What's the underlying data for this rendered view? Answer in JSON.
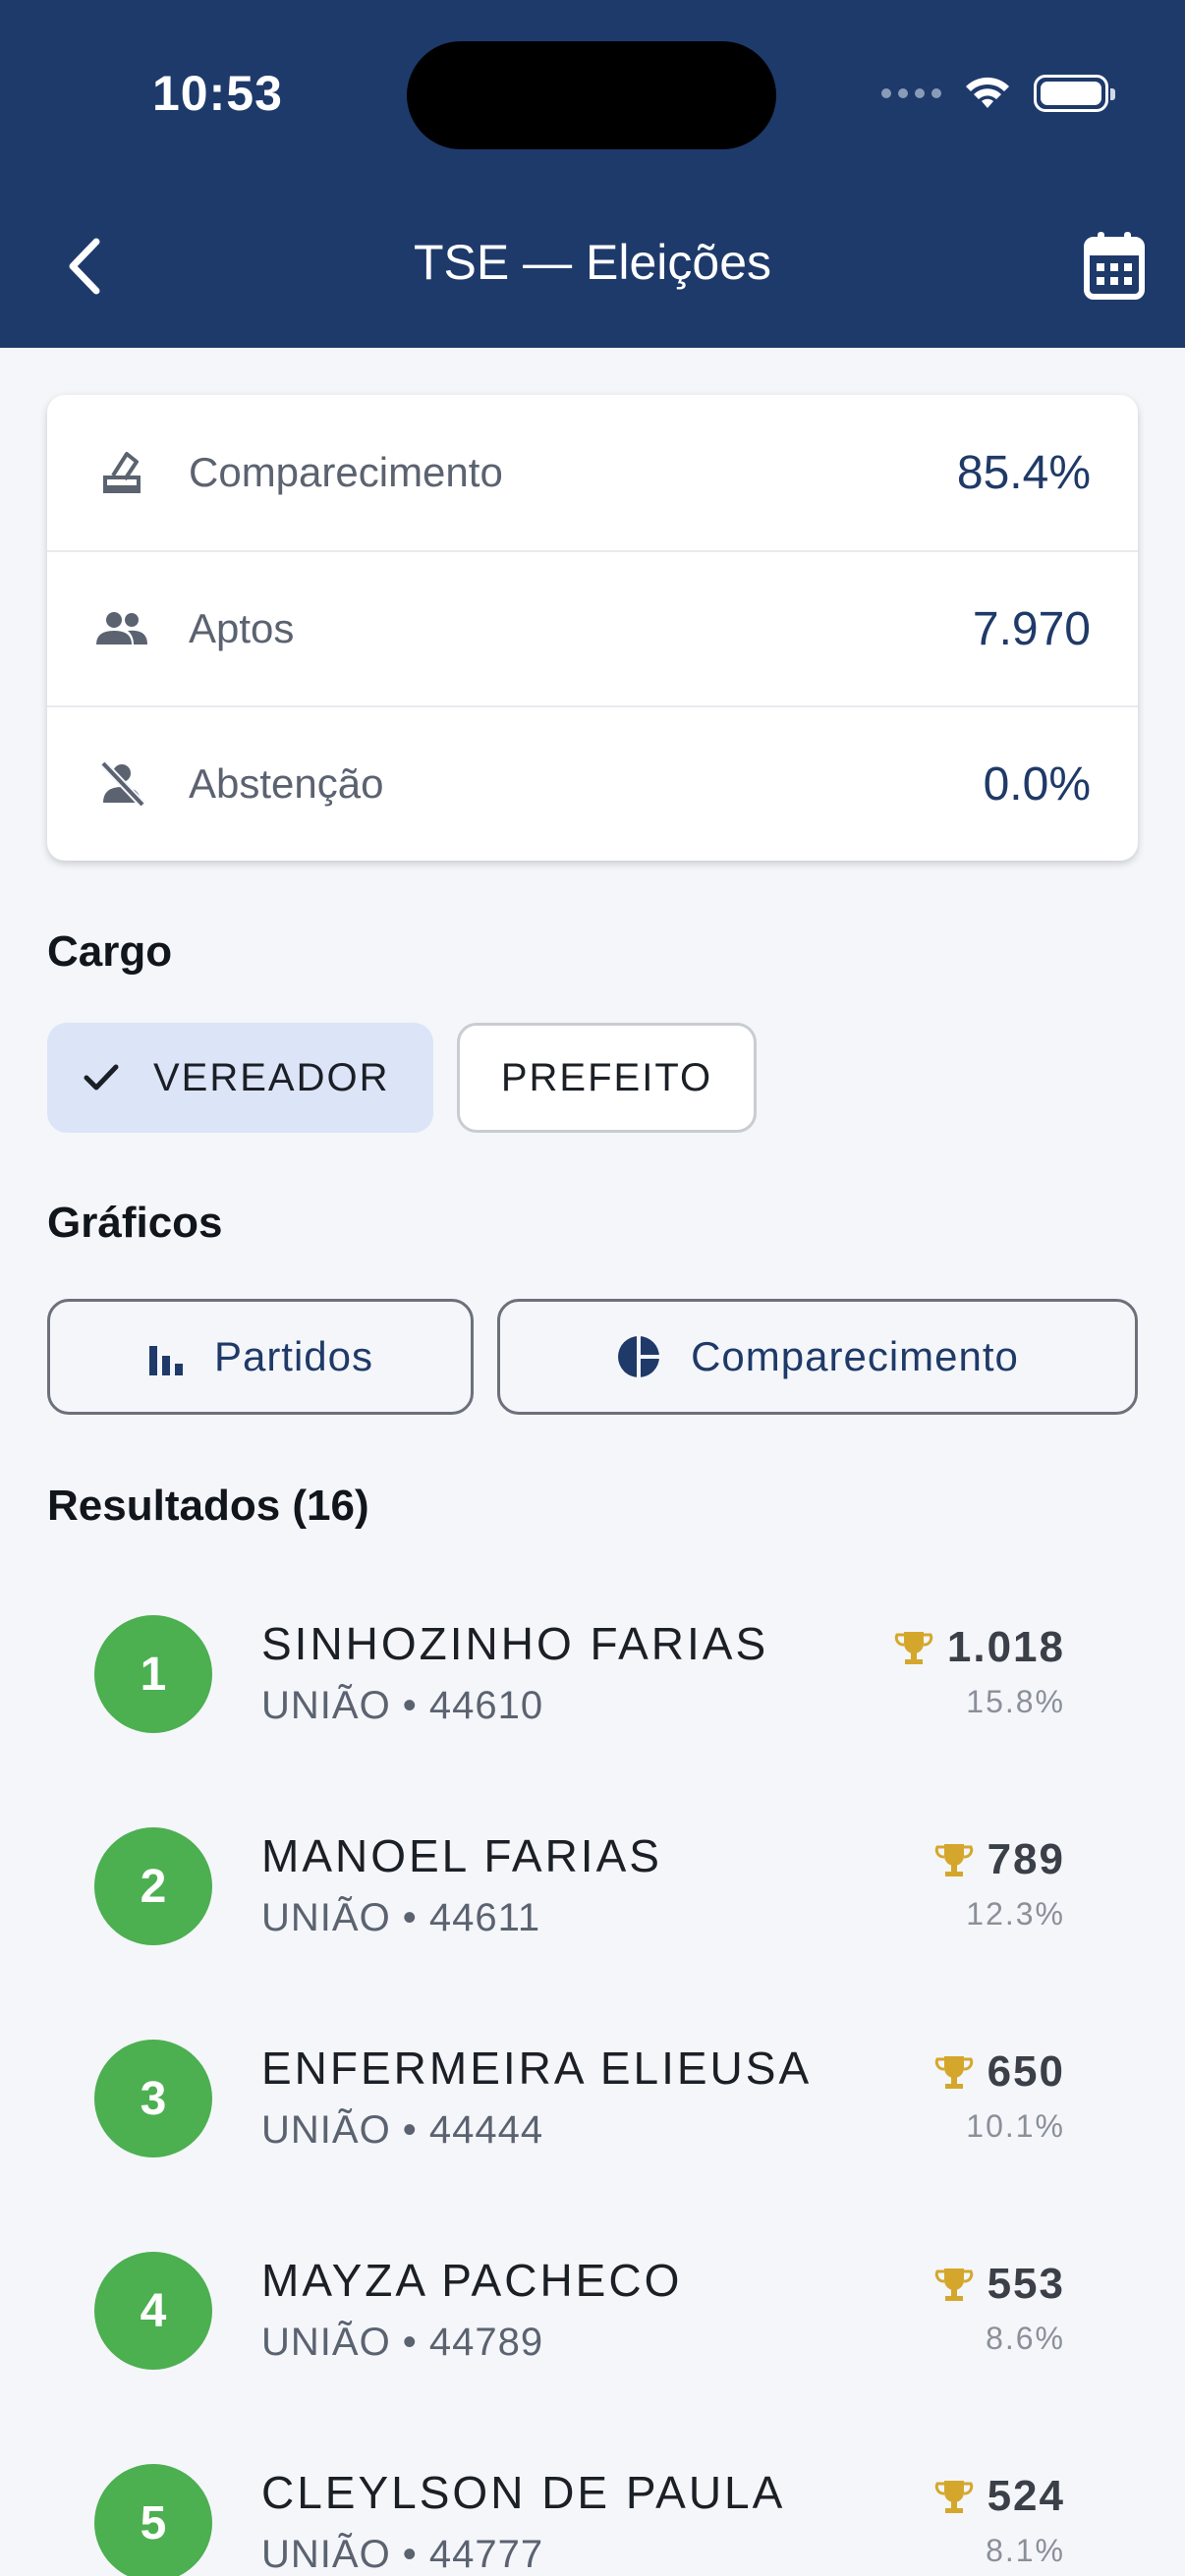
{
  "status_bar": {
    "time": "10:53"
  },
  "header": {
    "title": "TSE — Eleições"
  },
  "stats": [
    {
      "label": "Comparecimento",
      "value": "85.4%",
      "icon": "ballot-icon"
    },
    {
      "label": "Aptos",
      "value": "7.970",
      "icon": "people-icon"
    },
    {
      "label": "Abstenção",
      "value": "0.0%",
      "icon": "person-off-icon"
    }
  ],
  "cargo": {
    "title": "Cargo",
    "options": [
      {
        "label": "VEREADOR",
        "selected": true
      },
      {
        "label": "PREFEITO",
        "selected": false
      }
    ]
  },
  "graficos": {
    "title": "Gráficos",
    "buttons": [
      {
        "label": "Partidos",
        "icon": "bar-chart-icon"
      },
      {
        "label": "Comparecimento",
        "icon": "pie-chart-icon"
      }
    ]
  },
  "resultados": {
    "title": "Resultados (16)",
    "items": [
      {
        "rank": "1",
        "name": "SINHOZINHO FARIAS",
        "party": "UNIÃO • 44610",
        "votes": "1.018",
        "pct": "15.8%"
      },
      {
        "rank": "2",
        "name": "MANOEL FARIAS",
        "party": "UNIÃO • 44611",
        "votes": "789",
        "pct": "12.3%"
      },
      {
        "rank": "3",
        "name": "ENFERMEIRA ELIEUSA",
        "party": "UNIÃO • 44444",
        "votes": "650",
        "pct": "10.1%"
      },
      {
        "rank": "4",
        "name": "MAYZA PACHECO",
        "party": "UNIÃO • 44789",
        "votes": "553",
        "pct": "8.6%"
      },
      {
        "rank": "5",
        "name": "CLEYLSON DE PAULA",
        "party": "UNIÃO • 44777",
        "votes": "524",
        "pct": "8.1%"
      }
    ]
  },
  "colors": {
    "header": "#1e3a6b",
    "accent": "#1f3a68",
    "rank_badge": "#4caf50",
    "trophy": "#d4a72c",
    "chip_selected": "#dce4f7"
  }
}
